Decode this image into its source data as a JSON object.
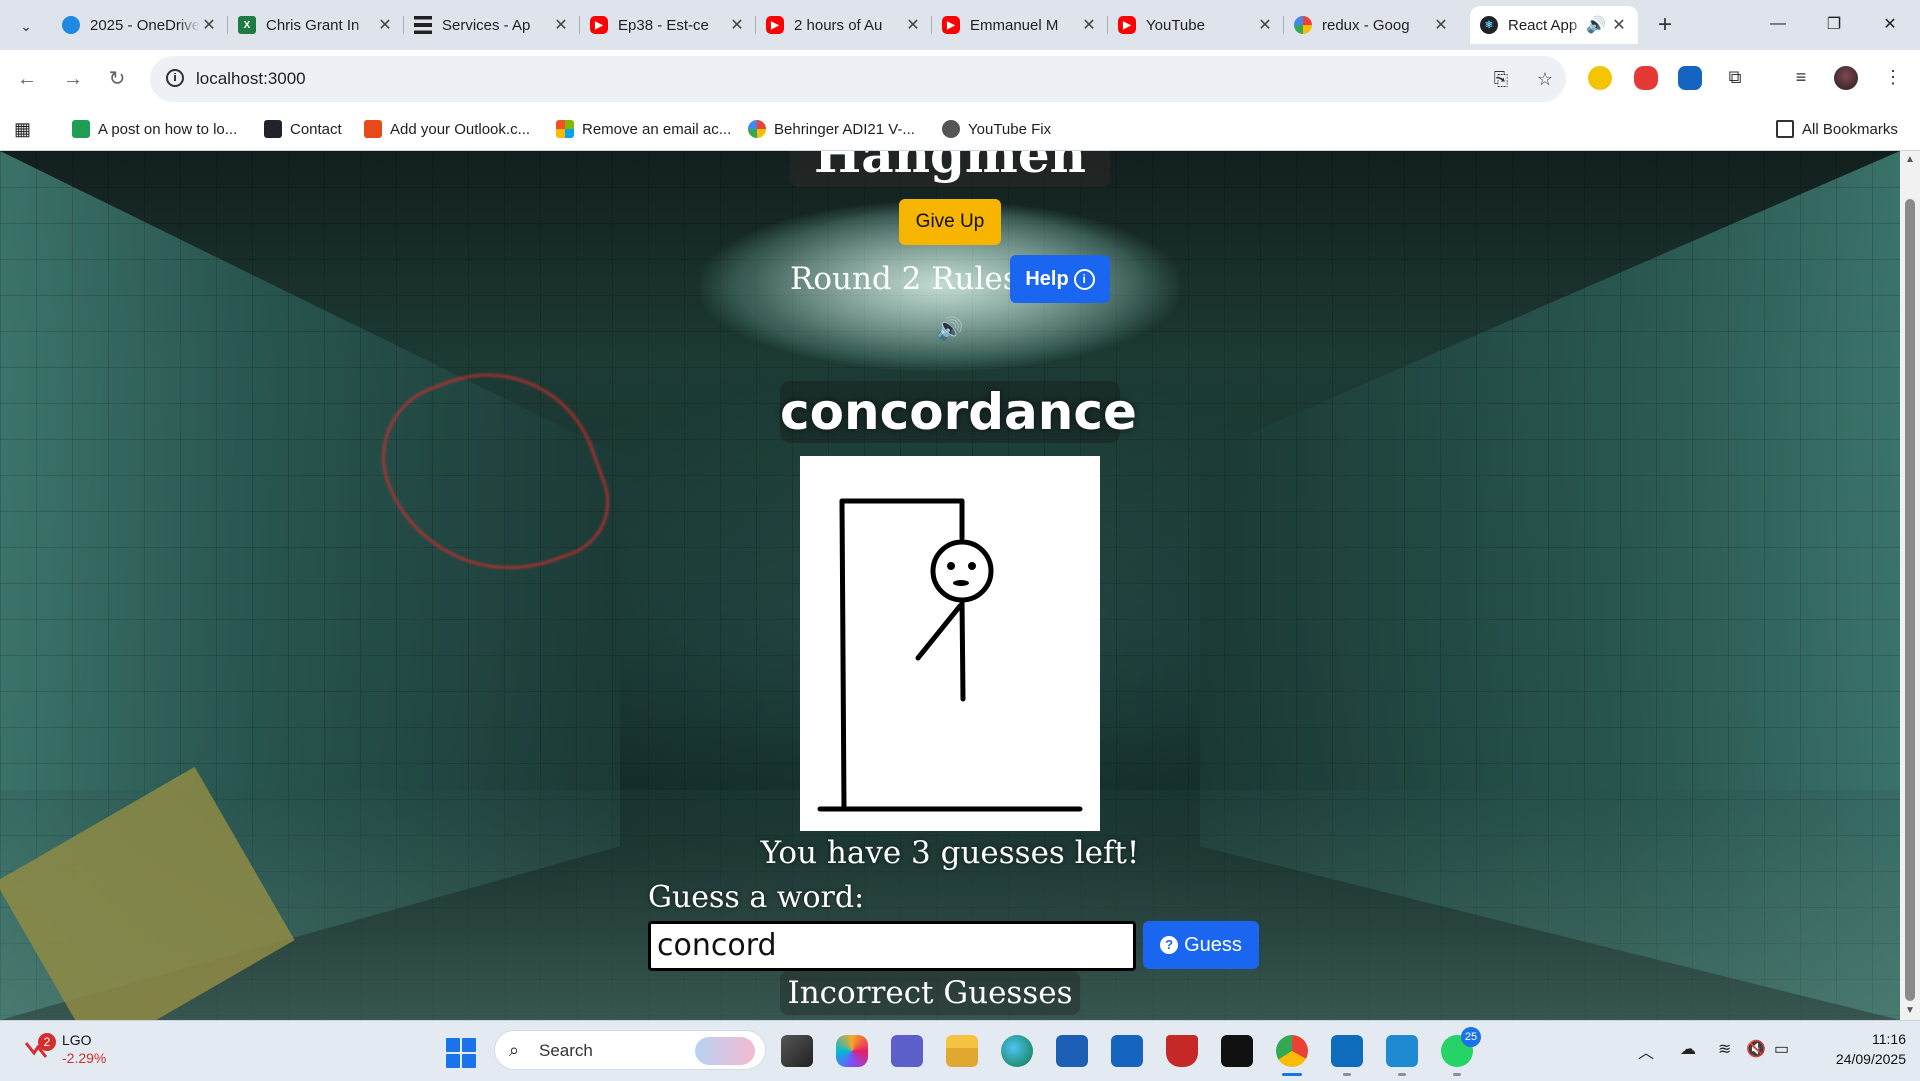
{
  "tabs": [
    {
      "title": "2025 - OneDrive",
      "icon": "onedrive-icon",
      "color": "#1e88e5"
    },
    {
      "title": "Chris Grant In",
      "icon": "excel-icon",
      "color": "#1f7a43"
    },
    {
      "title": "Services - Ap",
      "icon": "menu-lines-icon",
      "color": "#222222"
    },
    {
      "title": "Ep38 - Est-ce",
      "icon": "youtube-icon",
      "color": "#ff0000"
    },
    {
      "title": "2 hours of Au",
      "icon": "youtube-icon",
      "color": "#ff0000"
    },
    {
      "title": "Emmanuel M",
      "icon": "youtube-icon",
      "color": "#ff0000"
    },
    {
      "title": "YouTube",
      "icon": "youtube-icon",
      "color": "#ff0000"
    },
    {
      "title": "redux - Goog",
      "icon": "google-icon",
      "color": "#4285f4"
    },
    {
      "title": "React App",
      "icon": "react-icon",
      "color": "#20232a",
      "active": true
    }
  ],
  "address": {
    "url": "localhost:3000"
  },
  "bookmarks": [
    {
      "label": "A post on how to lo...",
      "color": "#1f9d55"
    },
    {
      "label": "Contact",
      "color": "#20232a"
    },
    {
      "label": "Add your Outlook.c...",
      "color": "#e64a19"
    },
    {
      "label": "Remove an email ac...",
      "color": "#f25022"
    },
    {
      "label": "Behringer ADI21 V-...",
      "color": "#fbbc05"
    },
    {
      "label": "YouTube Fix",
      "color": "#555555"
    }
  ],
  "all_bookmarks": "All Bookmarks",
  "game": {
    "title": "Hangmen",
    "give_up": "Give Up",
    "rules": "Round 2 Rules -",
    "help": "Help",
    "help_icon": "i",
    "word": "concordance",
    "guesses_left": "You have 3 guesses left!",
    "guess_label": "Guess a word:",
    "guess_value": "concord",
    "guess_button": "Guess",
    "guess_icon": "?",
    "incorrect_heading": "Incorrect Guesses"
  },
  "taskbar": {
    "stock": {
      "name": "LGO",
      "change": "-2.29%",
      "badge": "2"
    },
    "search": "Search",
    "whatsapp_badge": "25",
    "time": "11:16",
    "date": "24/09/2025"
  },
  "colors": {
    "accent_blue": "#1a66f0",
    "give_up_yellow": "#f7b500"
  }
}
